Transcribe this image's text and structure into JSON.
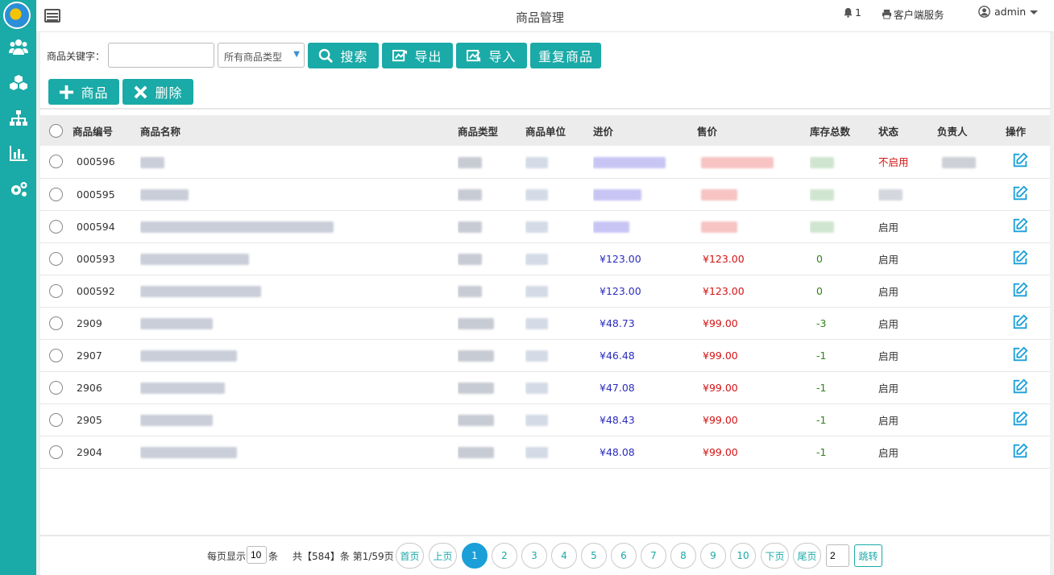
{
  "header": {
    "title": "商品管理",
    "notif_count": "1",
    "service_label": "客户端服务",
    "user": "admin",
    "icons": [
      "menu-toggle-icon",
      "bell-icon",
      "printer-icon",
      "user-circle-icon",
      "caret-down-icon"
    ]
  },
  "sidebar": {
    "items": [
      {
        "icon": "users-icon"
      },
      {
        "icon": "cubes-icon"
      },
      {
        "icon": "sitemap-icon"
      },
      {
        "icon": "bar-chart-icon"
      },
      {
        "icon": "gears-icon"
      }
    ],
    "accent_color": "#1aaaa7"
  },
  "toolbar": {
    "keyword_label": "商品关键字：",
    "keyword_value": "",
    "type_select_value": "所有商品类型",
    "search_label": "搜索",
    "export_label": "导出",
    "import_label": "导入",
    "duplicate_label": "重复商品",
    "add_label": "商品",
    "delete_label": "删除"
  },
  "table": {
    "columns": [
      "商品编号",
      "商品名称",
      "商品类型",
      "商品单位",
      "进价",
      "售价",
      "库存总数",
      "状态",
      "负责人",
      "操作"
    ],
    "rows": [
      {
        "id": "000596",
        "buy": "",
        "sell": "",
        "stock": "",
        "status": "不启用"
      },
      {
        "id": "000595",
        "buy": "",
        "sell": "",
        "stock": "",
        "status": ""
      },
      {
        "id": "000594",
        "buy": "",
        "sell": "",
        "stock": "",
        "status": "启用"
      },
      {
        "id": "000593",
        "buy": "¥123.00",
        "sell": "¥123.00",
        "stock": "0",
        "status": "启用"
      },
      {
        "id": "000592",
        "buy": "¥123.00",
        "sell": "¥123.00",
        "stock": "0",
        "status": "启用"
      },
      {
        "id": "2909",
        "buy": "¥48.73",
        "sell": "¥99.00",
        "stock": "-3",
        "status": "启用"
      },
      {
        "id": "2907",
        "buy": "¥46.48",
        "sell": "¥99.00",
        "stock": "-1",
        "status": "启用"
      },
      {
        "id": "2906",
        "buy": "¥47.08",
        "sell": "¥99.00",
        "stock": "-1",
        "status": "启用"
      },
      {
        "id": "2905",
        "buy": "¥48.43",
        "sell": "¥99.00",
        "stock": "-1",
        "status": "启用"
      },
      {
        "id": "2904",
        "buy": "¥48.08",
        "sell": "¥99.00",
        "stock": "-1",
        "status": "启用"
      }
    ]
  },
  "pager": {
    "per_page_prefix": "每页显示",
    "per_page": "10",
    "per_page_suffix": "条",
    "total_text": "共【584】条 第1/59页",
    "first": "首页",
    "prev": "上页",
    "pages": [
      "1",
      "2",
      "3",
      "4",
      "5",
      "6",
      "7",
      "8",
      "9",
      "10"
    ],
    "current": "1",
    "next": "下页",
    "last": "尾页",
    "jump_value": "2",
    "jump_label": "跳转"
  }
}
